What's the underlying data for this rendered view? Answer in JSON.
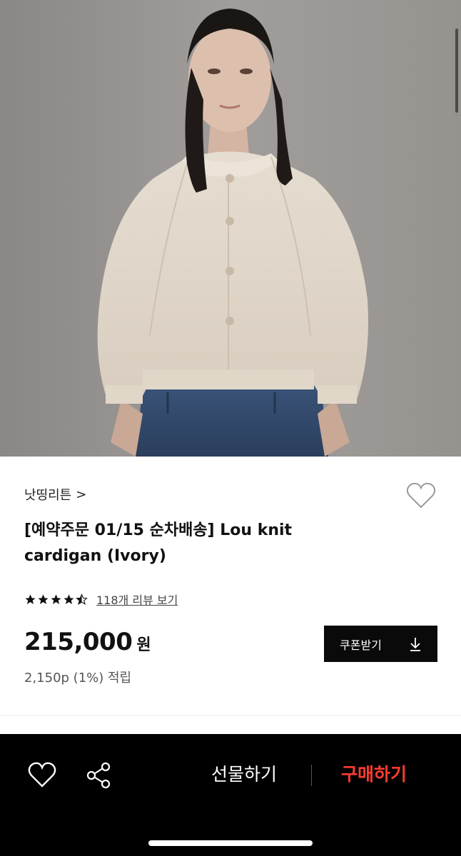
{
  "product": {
    "brand": "낫띵리튼",
    "brand_chevron": ">",
    "title": "[예약주문 01/15 순차배송] Lou knit cardigan (Ivory)",
    "rating_stars": 4.5,
    "review_link": "118개 리뷰 보기",
    "price": "215,000",
    "currency": "원",
    "points": "2,150p (1%) 적립"
  },
  "coupon": {
    "label": "쿠폰받기",
    "icon": "download-icon"
  },
  "bottom_bar": {
    "wishlist_icon": "heart-icon",
    "share_icon": "share-icon",
    "gift_label": "선물하기",
    "buy_label": "구매하기"
  },
  "colors": {
    "buy_accent": "#ff3b30",
    "bottom_bar": "#000000",
    "coupon_bg": "#0a0a0a"
  }
}
